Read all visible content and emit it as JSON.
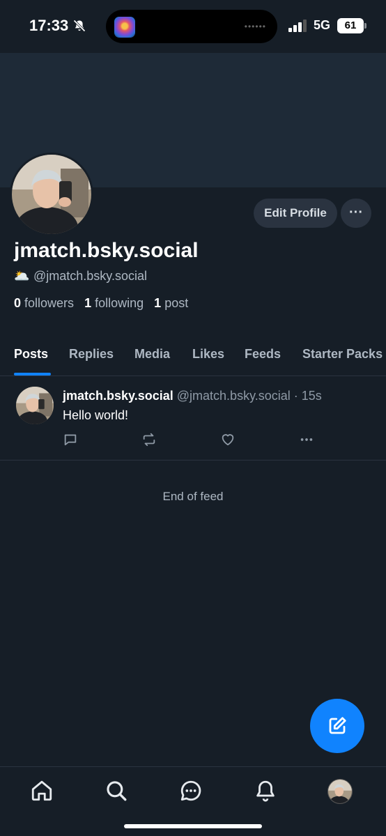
{
  "status_bar": {
    "time": "17:33",
    "network": "5G",
    "battery": "61"
  },
  "profile": {
    "display_name": "jmatch.bsky.social",
    "handle": "@jmatch.bsky.social",
    "handle_emoji": "🌥️",
    "followers_count": "0",
    "followers_label": "followers",
    "following_count": "1",
    "following_label": "following",
    "posts_count": "1",
    "posts_label": "post",
    "edit_profile_label": "Edit Profile",
    "more_label": "···"
  },
  "tabs": [
    {
      "label": "Posts"
    },
    {
      "label": "Replies"
    },
    {
      "label": "Media"
    },
    {
      "label": "Likes"
    },
    {
      "label": "Feeds"
    },
    {
      "label": "Starter Packs"
    }
  ],
  "post": {
    "author": "jmatch.bsky.social",
    "handle": "@jmatch.bsky.social",
    "time": "· 15s",
    "text": "Hello world!"
  },
  "feed": {
    "end_text": "End of feed"
  },
  "colors": {
    "background": "#161e27",
    "banner": "#1e2a37",
    "accent": "#1083fe",
    "button_bg": "#2a3340",
    "muted_text": "#aeb8c3"
  },
  "icons": {
    "nav": [
      "home-icon",
      "search-icon",
      "chat-icon",
      "bell-icon",
      "profile-avatar"
    ],
    "post_actions": [
      "reply-icon",
      "repost-icon",
      "like-icon",
      "more-icon"
    ],
    "fab": "compose-icon"
  }
}
